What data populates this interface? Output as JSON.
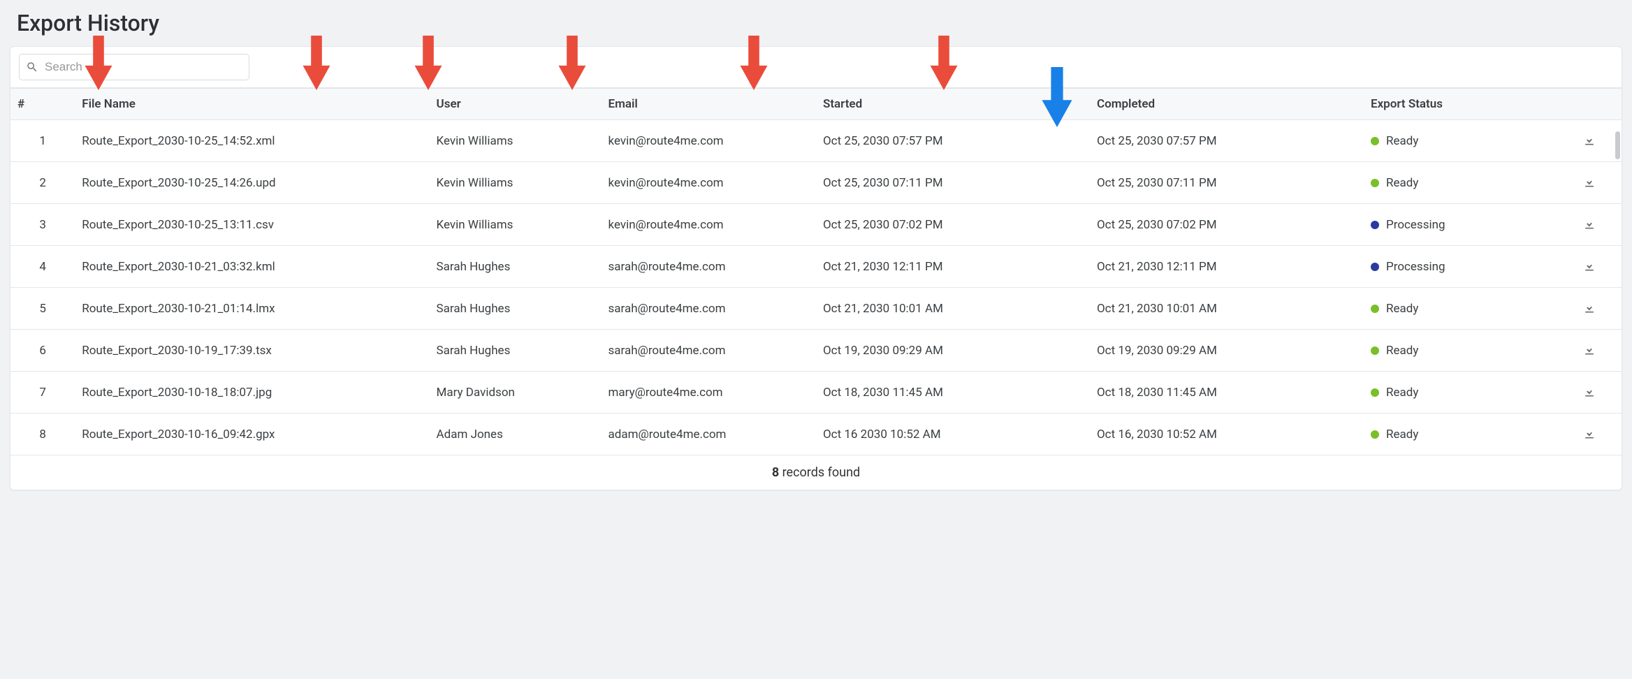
{
  "title": "Export History",
  "search": {
    "placeholder": "Search"
  },
  "columns": {
    "num": "#",
    "file": "File Name",
    "user": "User",
    "email": "Email",
    "started": "Started",
    "completed": "Completed",
    "status": "Export Status"
  },
  "statusColors": {
    "Ready": "green",
    "Processing": "blue"
  },
  "rows": [
    {
      "n": "1",
      "file": "Route_Export_2030-10-25_14:52.xml",
      "user": "Kevin Williams",
      "email": "kevin@route4me.com",
      "started": "Oct 25, 2030 07:57 PM",
      "completed": "Oct 25, 2030 07:57 PM",
      "status": "Ready"
    },
    {
      "n": "2",
      "file": "Route_Export_2030-10-25_14:26.upd",
      "user": "Kevin Williams",
      "email": "kevin@route4me.com",
      "started": "Oct 25, 2030 07:11 PM",
      "completed": "Oct 25, 2030 07:11 PM",
      "status": "Ready"
    },
    {
      "n": "3",
      "file": "Route_Export_2030-10-25_13:11.csv",
      "user": "Kevin Williams",
      "email": "kevin@route4me.com",
      "started": "Oct 25, 2030 07:02 PM",
      "completed": "Oct 25, 2030 07:02 PM",
      "status": "Processing"
    },
    {
      "n": "4",
      "file": "Route_Export_2030-10-21_03:32.kml",
      "user": "Sarah Hughes",
      "email": "sarah@route4me.com",
      "started": "Oct 21, 2030 12:11 PM",
      "completed": "Oct 21, 2030 12:11 PM",
      "status": "Processing"
    },
    {
      "n": "5",
      "file": "Route_Export_2030-10-21_01:14.lmx",
      "user": "Sarah Hughes",
      "email": "sarah@route4me.com",
      "started": "Oct 21, 2030 10:01 AM",
      "completed": "Oct 21, 2030 10:01 AM",
      "status": "Ready"
    },
    {
      "n": "6",
      "file": "Route_Export_2030-10-19_17:39.tsx",
      "user": "Sarah Hughes",
      "email": "sarah@route4me.com",
      "started": "Oct 19, 2030 09:29 AM",
      "completed": "Oct 19, 2030 09:29 AM",
      "status": "Ready"
    },
    {
      "n": "7",
      "file": "Route_Export_2030-10-18_18:07.jpg",
      "user": "Mary Davidson",
      "email": "mary@route4me.com",
      "started": "Oct 18, 2030 11:45 AM",
      "completed": "Oct 18, 2030 11:45 AM",
      "status": "Ready"
    },
    {
      "n": "8",
      "file": "Route_Export_2030-10-16_09:42.gpx",
      "user": "Adam Jones",
      "email": "adam@route4me.com",
      "started": "Oct 16 2030 10:52 AM",
      "completed": "Oct 16, 2030 10:52 AM",
      "status": "Ready"
    }
  ],
  "footer": {
    "count": "8",
    "label": " records found"
  }
}
